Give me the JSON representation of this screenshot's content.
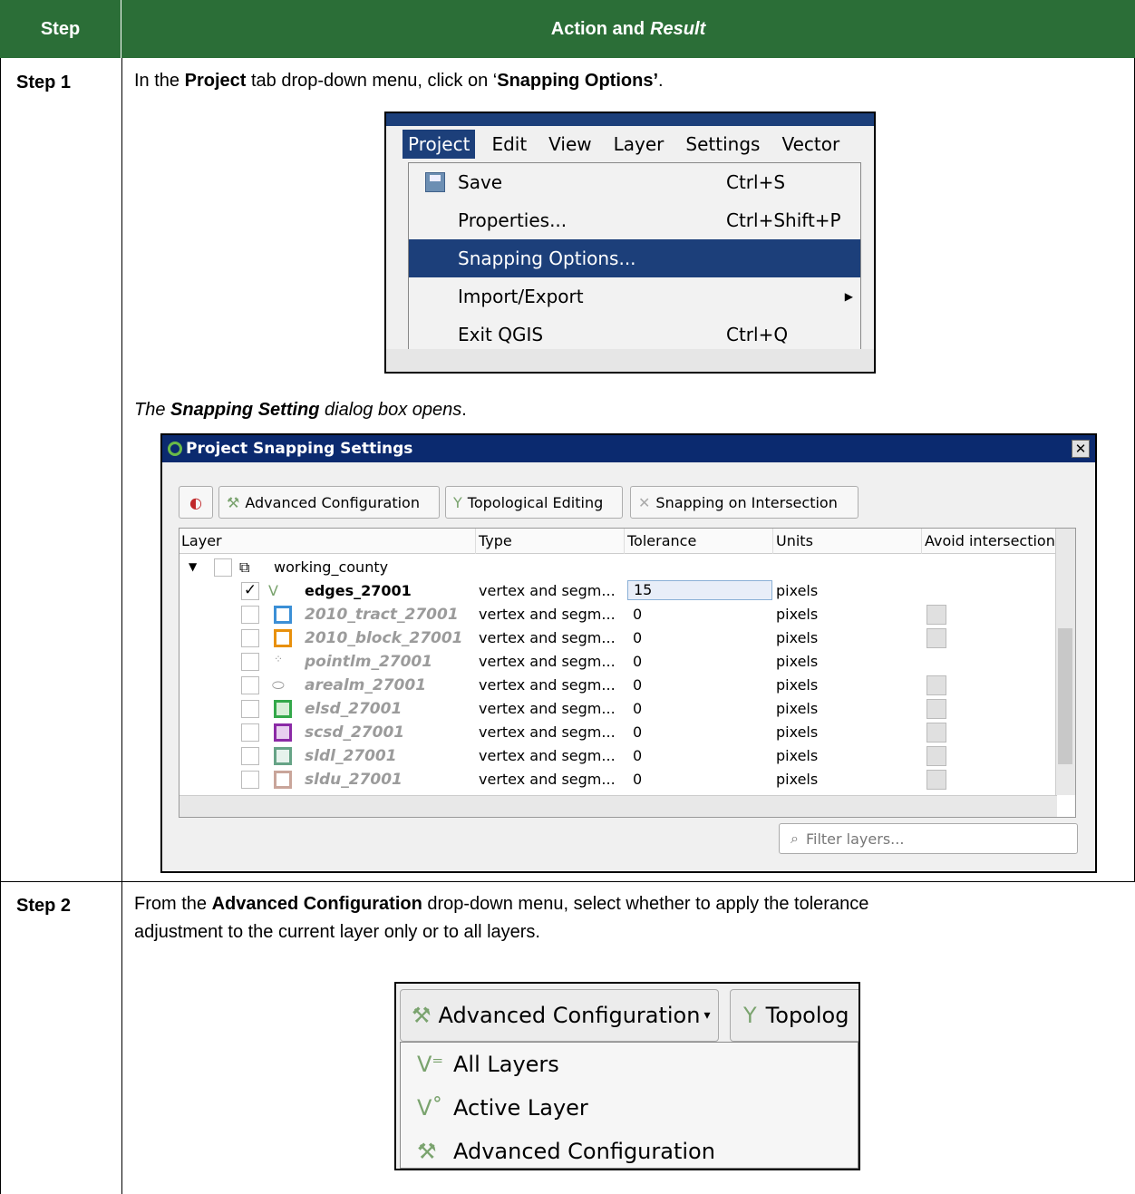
{
  "header": {
    "step": "Step",
    "action": "Action and",
    "result": "Result"
  },
  "step1": {
    "label": "Step 1",
    "text_a": "In the ",
    "text_b": "Project",
    "text_c": " tab drop-down menu, click on ‘",
    "text_d": "Snapping Options’",
    "text_e": ".",
    "result_a": "The ",
    "result_b": "Snapping Setting",
    "result_c": " dialog box opens",
    "result_d": "."
  },
  "menu": {
    "bar": [
      "Project",
      "Edit",
      "View",
      "Layer",
      "Settings",
      "Vector"
    ],
    "items": [
      {
        "label": "Save",
        "shortcut": "Ctrl+S"
      },
      {
        "label": "Properties...",
        "shortcut": "Ctrl+Shift+P"
      },
      {
        "label": "Snapping Options...",
        "shortcut": ""
      },
      {
        "label": "Import/Export",
        "shortcut": ""
      },
      {
        "label": "Exit QGIS",
        "shortcut": "Ctrl+Q"
      }
    ]
  },
  "dialog": {
    "title": "Project Snapping Settings",
    "buttons": {
      "advanced": "Advanced Configuration",
      "topological": "Topological Editing",
      "intersection": "Snapping on Intersection"
    },
    "columns": [
      "Layer",
      "Type",
      "Tolerance",
      "Units",
      "Avoid intersection"
    ],
    "group": "working_county",
    "rows": [
      {
        "name": "edges_27001",
        "type": "vertex and segm...",
        "tol": "15",
        "units": "pixels"
      },
      {
        "name": "2010_tract_27001",
        "type": "vertex and segm...",
        "tol": "0",
        "units": "pixels"
      },
      {
        "name": "2010_block_27001",
        "type": "vertex and segm...",
        "tol": "0",
        "units": "pixels"
      },
      {
        "name": "pointlm_27001",
        "type": "vertex and segm...",
        "tol": "0",
        "units": "pixels"
      },
      {
        "name": "arealm_27001",
        "type": "vertex and segm...",
        "tol": "0",
        "units": "pixels"
      },
      {
        "name": "elsd_27001",
        "type": "vertex and segm...",
        "tol": "0",
        "units": "pixels"
      },
      {
        "name": "scsd_27001",
        "type": "vertex and segm...",
        "tol": "0",
        "units": "pixels"
      },
      {
        "name": "sldl_27001",
        "type": "vertex and segm...",
        "tol": "0",
        "units": "pixels"
      },
      {
        "name": "sldu_27001",
        "type": "vertex and segm...",
        "tol": "0",
        "units": "pixels"
      }
    ],
    "filter_placeholder": "Filter layers..."
  },
  "step2": {
    "label": "Step 2",
    "line1_a": "From the ",
    "line1_b": "Advanced Configuration",
    "line1_c": " drop-down menu, select whether to apply the tolerance",
    "line2": "adjustment to the current layer only or to all layers."
  },
  "adv": {
    "button": "Advanced Configuration",
    "next": "Topolog",
    "items": [
      "All Layers",
      "Active Layer",
      "Advanced Configuration"
    ]
  },
  "colors": {
    "header_green": "#2b6e37",
    "qgis_blue": "#1c3f7a",
    "swatches": [
      "#3b8fd6",
      "#e8900b",
      "#33a84a",
      "#8b2aa6",
      "#66a386",
      "#c9a59a"
    ]
  }
}
